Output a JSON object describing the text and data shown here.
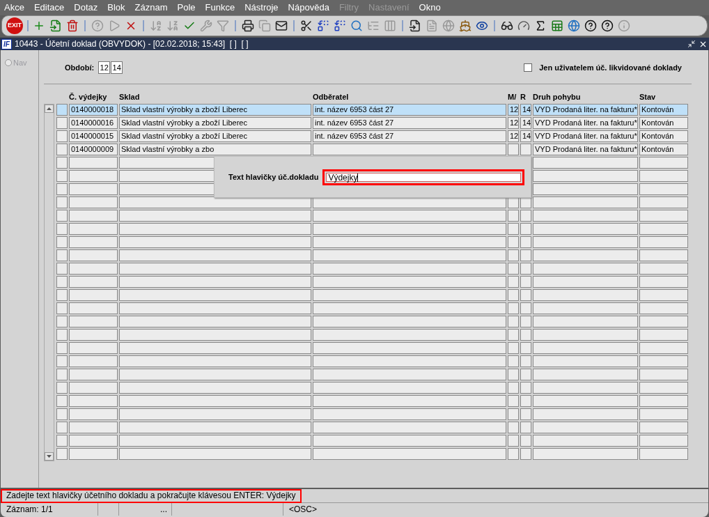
{
  "menu": [
    {
      "label": "Akce",
      "disabled": false
    },
    {
      "label": "Editace",
      "disabled": false
    },
    {
      "label": "Dotaz",
      "disabled": false
    },
    {
      "label": "Blok",
      "disabled": false
    },
    {
      "label": "Záznam",
      "disabled": false
    },
    {
      "label": "Pole",
      "disabled": false
    },
    {
      "label": "Funkce",
      "disabled": false
    },
    {
      "label": "Nástroje",
      "disabled": false
    },
    {
      "label": "Nápověda",
      "disabled": false
    },
    {
      "label": "Filtry",
      "disabled": true
    },
    {
      "label": "Nastavení",
      "disabled": true
    },
    {
      "label": "Okno",
      "disabled": false
    }
  ],
  "toolbar": {
    "exit_label": "EXIT"
  },
  "window": {
    "title": "10443 - Účetní doklad (OBVYDOK) - [02.02.2018; 15:43]  [ ]  [ ]",
    "logo": "IF"
  },
  "nav": {
    "label": "Nav",
    "selected": false
  },
  "period": {
    "label": "Období:",
    "month": "12",
    "year": "14"
  },
  "filter_checkbox": {
    "label": "Jen uživatelem úč. likvidované doklady",
    "checked": false
  },
  "table": {
    "columns": [
      "Č. výdejky",
      "Sklad",
      "Odběratel",
      "M/",
      "R",
      "Druh pohybu",
      "Stav"
    ],
    "rows": [
      {
        "selected": true,
        "cells": [
          "0140000018",
          "Sklad vlastní výrobky a zboží Liberec",
          "int. název 6953 část 27",
          "12",
          "14",
          "VYD Prodaná liter. na fakturu*",
          "Kontován"
        ]
      },
      {
        "selected": false,
        "cells": [
          "0140000016",
          "Sklad vlastní výrobky a zboží Liberec",
          "int. název 6953 část 27",
          "12",
          "14",
          "VYD Prodaná liter. na fakturu*",
          "Kontován"
        ]
      },
      {
        "selected": false,
        "cells": [
          "0140000015",
          "Sklad vlastní výrobky a zboží Liberec",
          "int. název 6953 část 27",
          "12",
          "14",
          "VYD Prodaná liter. na fakturu*",
          "Kontován"
        ]
      },
      {
        "selected": false,
        "cells": [
          "0140000009",
          "Sklad vlastní výrobky a zbo",
          null,
          null,
          null,
          "VYD Prodaná liter. na fakturu*",
          "Kontován"
        ]
      }
    ]
  },
  "dialog": {
    "label": "Text hlavičky úč.dokladu",
    "value": "Výdejky",
    "highlighted": true
  },
  "status_bar": {
    "message": "Zadejte text hlavičky účetního dokladu a pokračujte klávesou ENTER: Výdejky",
    "highlighted": true,
    "record": "Záznam: 1/1",
    "ellipsis": "...",
    "mode": "<OSC>"
  }
}
